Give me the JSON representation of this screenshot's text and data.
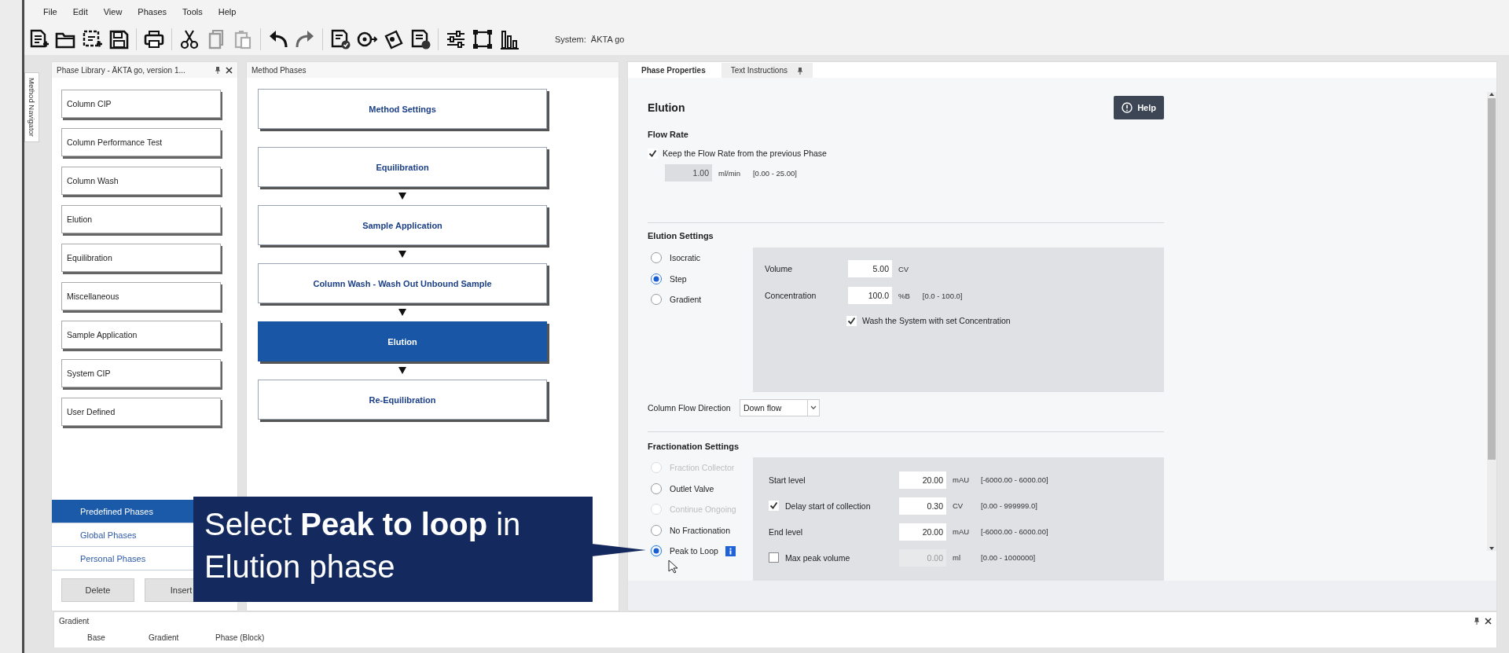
{
  "menu": [
    "File",
    "Edit",
    "View",
    "Phases",
    "Tools",
    "Help"
  ],
  "system_label": "System:  ÄKTA go",
  "side_tab": "Method Navigator",
  "phase_library": {
    "title": "Phase Library - ÄKTA go, version 1...",
    "items": [
      "Column CIP",
      "Column Performance Test",
      "Column Wash",
      "Elution",
      "Equilibration",
      "Miscellaneous",
      "Sample Application",
      "System CIP",
      "User Defined"
    ],
    "categories": [
      {
        "label": "Predefined Phases",
        "selected": true
      },
      {
        "label": "Global Phases",
        "selected": false
      },
      {
        "label": "Personal Phases",
        "selected": false
      }
    ],
    "buttons": [
      "Delete",
      "Insert"
    ]
  },
  "method_phases": {
    "title": "Method Phases",
    "blocks": [
      {
        "label": "Method Settings",
        "selected": false
      },
      {
        "label": "Equilibration",
        "selected": false,
        "linked": false
      },
      {
        "label": "Sample Application",
        "selected": false,
        "linked": true
      },
      {
        "label": "Column Wash - Wash Out Unbound Sample",
        "selected": false,
        "linked": true
      },
      {
        "label": "Elution",
        "selected": true,
        "linked": true
      },
      {
        "label": "Re-Equilibration",
        "selected": false,
        "linked": true
      }
    ]
  },
  "properties": {
    "tabs": [
      {
        "label": "Phase Properties",
        "selected": true,
        "pinned": false
      },
      {
        "label": "Text Instructions",
        "selected": false,
        "pinned": true
      }
    ],
    "title": "Elution",
    "help": "Help",
    "flow_rate": {
      "heading": "Flow Rate",
      "keep": {
        "label": "Keep the Flow Rate from the previous Phase",
        "checked": true
      },
      "value": "1.00",
      "unit": "ml/min",
      "range": "[0.00 - 25.00]",
      "disabled": true
    },
    "elution_settings": {
      "heading": "Elution Settings",
      "options": [
        {
          "label": "Isocratic",
          "selected": false,
          "disabled": false
        },
        {
          "label": "Step",
          "selected": true,
          "disabled": false
        },
        {
          "label": "Gradient",
          "selected": false,
          "disabled": false
        }
      ],
      "fields": [
        {
          "label": "Volume",
          "value": "5.00",
          "unit": "CV"
        },
        {
          "label": "Concentration",
          "value": "100.0",
          "unit": "%B",
          "range": "[0.0 - 100.0]"
        }
      ],
      "wash": {
        "label": "Wash the System with set Concentration",
        "checked": true
      }
    },
    "flow_direction": {
      "label": "Column Flow Direction",
      "value": "Down flow"
    },
    "fractionation": {
      "heading": "Fractionation Settings",
      "options": [
        {
          "label": "Fraction Collector",
          "selected": false,
          "disabled": true,
          "info": false
        },
        {
          "label": "Outlet Valve",
          "selected": false,
          "disabled": false,
          "info": false
        },
        {
          "label": "Continue Ongoing",
          "selected": false,
          "disabled": true,
          "info": false
        },
        {
          "label": "No Fractionation",
          "selected": false,
          "disabled": false,
          "info": false
        },
        {
          "label": "Peak to Loop",
          "selected": true,
          "disabled": false,
          "info": true
        }
      ],
      "fields": [
        {
          "kind": "plain",
          "label": "Start level",
          "value": "20.00",
          "unit": "mAU",
          "range": "[-6000.00 - 6000.00]",
          "disabled": false
        },
        {
          "kind": "check",
          "label": "Delay start of collection",
          "checked": true,
          "value": "0.30",
          "unit": "CV",
          "range": "[0.00 - 999999.0]",
          "disabled": false
        },
        {
          "kind": "plain",
          "label": "End level",
          "value": "20.00",
          "unit": "mAU",
          "range": "[-6000.00 - 6000.00]",
          "disabled": false
        },
        {
          "kind": "check",
          "label": "Max peak volume",
          "checked": false,
          "value": "0.00",
          "unit": "ml",
          "range": "[0.00 - 1000000]",
          "disabled": true
        }
      ]
    }
  },
  "gradient_panel": {
    "title": "Gradient",
    "columns": [
      "Base",
      "Gradient",
      "Phase (Block)"
    ]
  },
  "callout": "Select **Peak to loop** in Elution phase"
}
